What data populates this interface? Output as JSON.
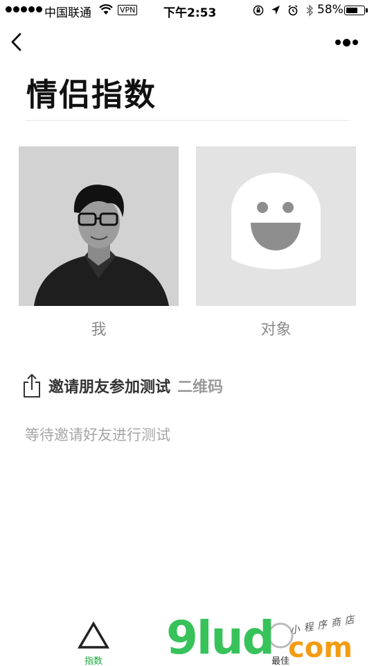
{
  "status_bar": {
    "carrier": "中国联通",
    "vpn": "VPN",
    "time": "下午2:53",
    "battery_pct": "58%"
  },
  "page": {
    "title": "情侣指数"
  },
  "participants": [
    {
      "label": "我"
    },
    {
      "label": "对象"
    }
  ],
  "invite": {
    "text": "邀请朋友参加测试",
    "qr_label": "二维码",
    "waiting": "等待邀请好友进行测试"
  },
  "tabs": [
    {
      "label": "指数",
      "active": true,
      "icon": "triangle-icon"
    },
    {
      "label": "最佳",
      "active": false,
      "icon": "circle-icon"
    }
  ],
  "watermark": {
    "main": "9lud",
    "com": "com",
    "sub": "小程序商店"
  },
  "colors": {
    "accent_green": "#18a93b",
    "watermark_green": "#37c25a",
    "watermark_orange": "#f39c12"
  }
}
